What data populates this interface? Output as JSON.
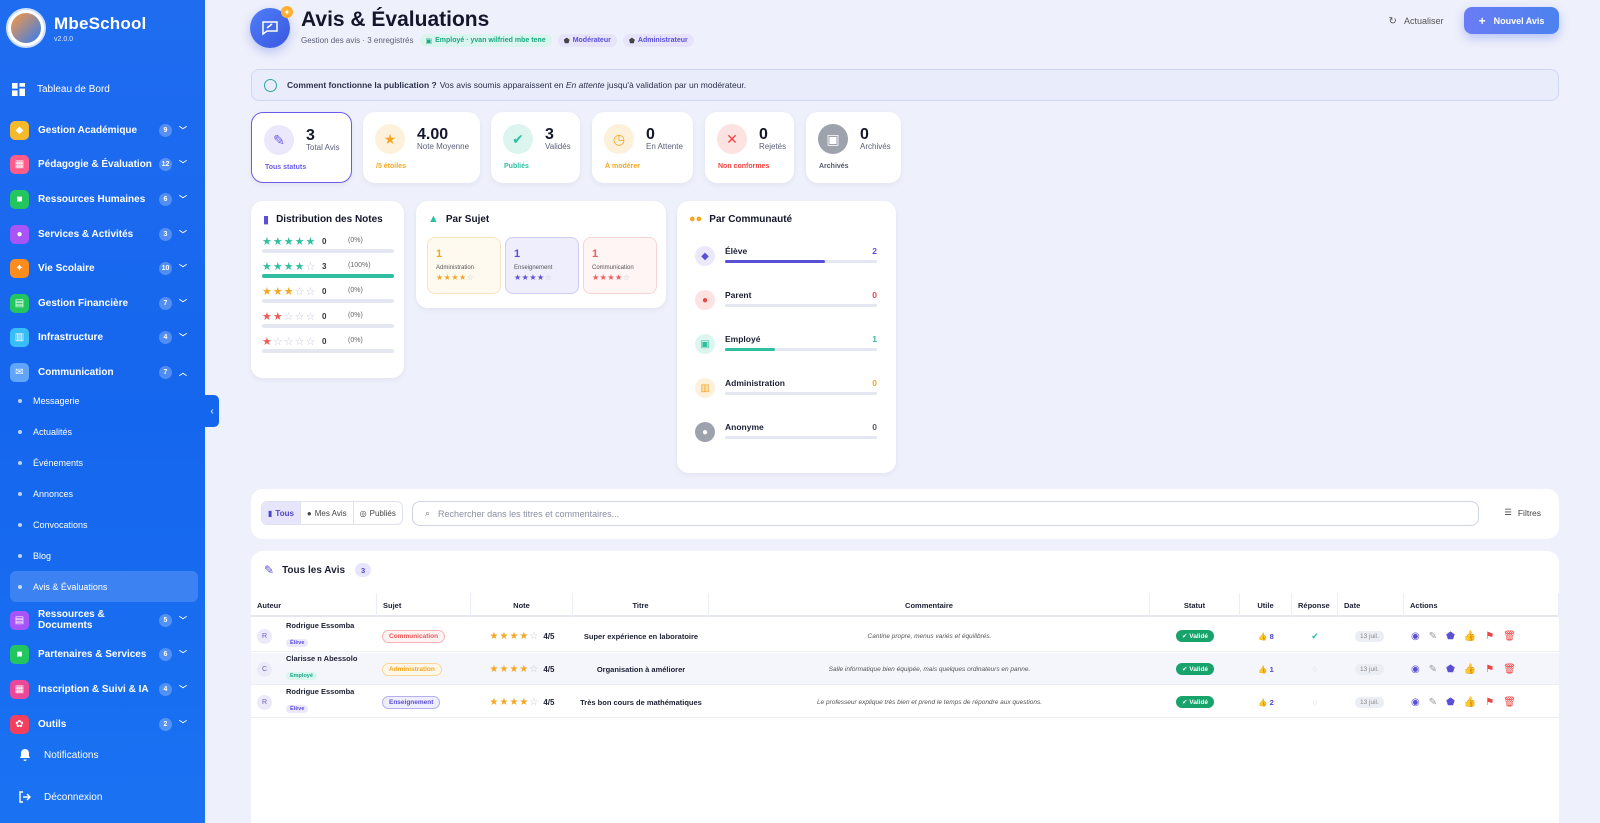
{
  "app": {
    "name": "MbeSchool",
    "version": "v2.0.0"
  },
  "sidebar": {
    "top_item": "Tableau de Bord",
    "groups": [
      {
        "label": "Gestion Académique",
        "count": "9",
        "color": "#f6b92b",
        "icon": "graduation-icon",
        "glyph": "◆"
      },
      {
        "label": "Pédagogie & Évaluation",
        "count": "12",
        "color": "#ff5c8a",
        "icon": "evaluation-icon",
        "glyph": "▦"
      },
      {
        "label": "Ressources Humaines",
        "count": "6",
        "color": "#22c55e",
        "icon": "briefcase-icon",
        "glyph": "■"
      },
      {
        "label": "Services & Activités",
        "count": "3",
        "color": "#a855f7",
        "icon": "activities-icon",
        "glyph": "●"
      },
      {
        "label": "Vie Scolaire",
        "count": "10",
        "color": "#fb8c1e",
        "icon": "student-life-icon",
        "glyph": "✦"
      },
      {
        "label": "Gestion Financière",
        "count": "7",
        "color": "#22c55e",
        "icon": "finance-icon",
        "glyph": "▤"
      },
      {
        "label": "Infrastructure",
        "count": "4",
        "color": "#38bdf8",
        "icon": "building-icon",
        "glyph": "▥"
      },
      {
        "label": "Communication",
        "count": "7",
        "color": "#60a5fa",
        "icon": "mail-icon",
        "glyph": "✉"
      }
    ],
    "sub_items": [
      "Messagerie",
      "Actualités",
      "Événements",
      "Annonces",
      "Convocations",
      "Blog",
      "Avis & Évaluations"
    ],
    "groups2": [
      {
        "label": "Ressources & Documents",
        "count": "5",
        "color": "#a855f7",
        "icon": "documents-icon",
        "glyph": "▤"
      },
      {
        "label": "Partenaires & Services",
        "count": "6",
        "color": "#22c55e",
        "icon": "partners-icon",
        "glyph": "■"
      },
      {
        "label": "Inscription & Suivi & IA",
        "count": "4",
        "color": "#ec4899",
        "icon": "enrollment-icon",
        "glyph": "▦"
      },
      {
        "label": "Outils",
        "count": "2",
        "color": "#f43f5e",
        "icon": "tools-icon",
        "glyph": "✿"
      }
    ],
    "notifications": "Notifications",
    "logout": "Déconnexion"
  },
  "header": {
    "title": "Avis & Évaluations",
    "subtitle": "Gestion des avis · 3 enregistrés",
    "tag_employee": "Employé · yvan wilfried mbe tene",
    "tag_moderator": "Modérateur",
    "tag_admin": "Administrateur",
    "refresh_label": "Actualiser",
    "new_label": "Nouvel Avis"
  },
  "banner": {
    "bold": "Comment fonctionne la publication ?",
    "text1": "Vos avis soumis apparaissent en",
    "italic": "En attente",
    "text2": "jusqu'à validation par un modérateur."
  },
  "stats": [
    {
      "value": "3",
      "label": "Total Avis",
      "foot": "Tous statuts",
      "color": "#6a5ce8",
      "bg": "#ebe8fb",
      "icon": "chat-icon",
      "glyph": "✎"
    },
    {
      "value": "4.00",
      "label": "Note Moyenne",
      "foot": "/5 étoiles",
      "color": "#f5a623",
      "bg": "#fdf1dc",
      "icon": "star-icon",
      "glyph": "★"
    },
    {
      "value": "3",
      "label": "Validés",
      "foot": "Publiés",
      "color": "#2fbfa0",
      "bg": "#dcf6ef",
      "icon": "check-icon",
      "glyph": "✔"
    },
    {
      "value": "0",
      "label": "En Attente",
      "foot": "À modérer",
      "color": "#f5a623",
      "bg": "#fdf1dc",
      "icon": "clock-icon",
      "glyph": "◷"
    },
    {
      "value": "0",
      "label": "Rejetés",
      "foot": "Non conformes",
      "color": "#ef4444",
      "bg": "#fde2e2",
      "icon": "reject-icon",
      "glyph": "✕"
    },
    {
      "value": "0",
      "label": "Archivés",
      "foot": "Archivés",
      "color": "#555a6b",
      "bg": "#9ea2ad",
      "icon": "lock-icon",
      "glyph": "▣"
    }
  ],
  "distribution": {
    "title": "Distribution des Notes",
    "rows": [
      {
        "stars": 5,
        "count": "0",
        "pct": "(0%)",
        "fill": 0,
        "color": "#2fbfa0"
      },
      {
        "stars": 4,
        "count": "3",
        "pct": "(100%)",
        "fill": 1,
        "color": "#2fbfa0"
      },
      {
        "stars": 3,
        "count": "0",
        "pct": "(0%)",
        "fill": 0,
        "color": "#f5a623"
      },
      {
        "stars": 2,
        "count": "0",
        "pct": "(0%)",
        "fill": 0,
        "color": "#ef5a5a"
      },
      {
        "stars": 1,
        "count": "0",
        "pct": "(0%)",
        "fill": 0,
        "color": "#ef5a5a"
      }
    ]
  },
  "subjects": {
    "title": "Par Sujet",
    "items": [
      {
        "count": "1",
        "label": "Administration",
        "color": "#f5a623",
        "bg": "#fffaf0",
        "border": "#fae3c0"
      },
      {
        "count": "1",
        "label": "Enseignement",
        "color": "#5b4fd6",
        "bg": "#efeefc",
        "border": "#cfcbf3"
      },
      {
        "count": "1",
        "label": "Communication",
        "color": "#ef5a5a",
        "bg": "#fff5f5",
        "border": "#f6d3d3"
      }
    ]
  },
  "community": {
    "title": "Par Communauté",
    "items": [
      {
        "label": "Élève",
        "value": "2",
        "fill": 0.66,
        "color": "#5b4fd6",
        "bg": "#ebe8fb",
        "icon": "graduation-cap-icon",
        "glyph": "◆"
      },
      {
        "label": "Parent",
        "value": "0",
        "fill": 0,
        "color": "#ef4444",
        "bg": "#fde2e2",
        "icon": "family-icon",
        "glyph": "●"
      },
      {
        "label": "Employé",
        "value": "1",
        "fill": 0.33,
        "color": "#2fbfa0",
        "bg": "#dcf6ef",
        "icon": "id-badge-icon",
        "glyph": "▣"
      },
      {
        "label": "Administration",
        "value": "0",
        "fill": 0,
        "color": "#f5a623",
        "bg": "#fdf1dc",
        "icon": "building-icon",
        "glyph": "▥"
      },
      {
        "label": "Anonyme",
        "value": "0",
        "fill": 0,
        "color": "#555a6b",
        "bg": "#9ea2ad",
        "icon": "anonymous-icon",
        "glyph": "●"
      }
    ]
  },
  "filterbar": {
    "tabs": [
      "Tous",
      "Mes Avis",
      "Publiés"
    ],
    "search_placeholder": "Rechercher dans les titres et commentaires...",
    "filters_label": "Filtres"
  },
  "table": {
    "title": "Tous les Avis",
    "count": "3",
    "columns": [
      "Auteur",
      "Sujet",
      "Note",
      "Titre",
      "Commentaire",
      "Statut",
      "Utile",
      "Réponse",
      "Date",
      "Actions"
    ],
    "rows": [
      {
        "initial": "R",
        "author": "Rodrigue Essomba",
        "role": "Élève",
        "role_color": "#5b4fd6",
        "role_bg": "#ebe8fb",
        "subject": "Communication",
        "subj_color": "#ef5a5a",
        "subj_bg": "#fff2f2",
        "rating": 4,
        "rating_label": "4/5",
        "title": "Super expérience en laboratoire",
        "comment": "Cantine propre, menus variés et équilibrés.",
        "status": "Validé",
        "useful": "8",
        "responded": true,
        "date": "13 juil."
      },
      {
        "initial": "C",
        "author": "Clarisse n Abessolo",
        "role": "Employé",
        "role_color": "#19a883",
        "role_bg": "#d9f5ee",
        "subject": "Administration",
        "subj_color": "#f5a623",
        "subj_bg": "#fff7e8",
        "rating": 4,
        "rating_label": "4/5",
        "title": "Organisation à améliorer",
        "comment": "Salle informatique bien équipée, mais quelques ordinateurs en panne.",
        "status": "Validé",
        "useful": "1",
        "responded": false,
        "date": "13 juil."
      },
      {
        "initial": "R",
        "author": "Rodrigue Essomba",
        "role": "Élève",
        "role_color": "#5b4fd6",
        "role_bg": "#ebe8fb",
        "subject": "Enseignement",
        "subj_color": "#5b4fd6",
        "subj_bg": "#efeefc",
        "rating": 4,
        "rating_label": "4/5",
        "title": "Très bon cours de mathématiques",
        "comment": "Le professeur explique très bien et prend le temps de répondre aux questions.",
        "status": "Validé",
        "useful": "2",
        "responded": false,
        "date": "13 juil."
      }
    ]
  }
}
